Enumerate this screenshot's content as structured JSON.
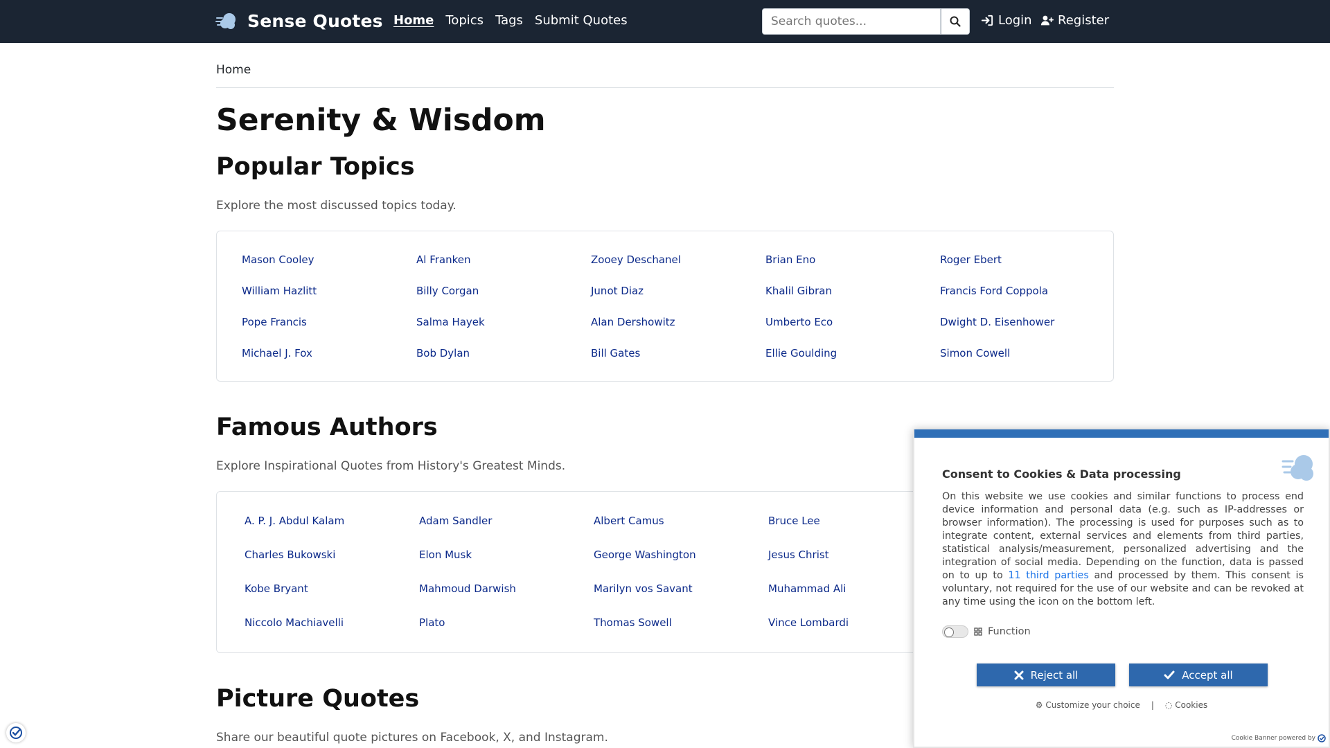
{
  "header": {
    "brand": "Sense Quotes",
    "nav": [
      "Home",
      "Topics",
      "Tags",
      "Submit Quotes"
    ],
    "search_placeholder": "Search quotes...",
    "login": "Login",
    "register": "Register"
  },
  "breadcrumb": "Home",
  "page_title": "Serenity & Wisdom",
  "popular_topics": {
    "title": "Popular Topics",
    "subtitle": "Explore the most discussed topics today.",
    "items": [
      "Mason Cooley",
      "Al Franken",
      "Zooey Deschanel",
      "Brian Eno",
      "Roger Ebert",
      "William Hazlitt",
      "Billy Corgan",
      "Junot Diaz",
      "Khalil Gibran",
      "Francis Ford Coppola",
      "Pope Francis",
      "Salma Hayek",
      "Alan Dershowitz",
      "Umberto Eco",
      "Dwight D. Eisenhower",
      "Michael J. Fox",
      "Bob Dylan",
      "Bill Gates",
      "Ellie Goulding",
      "Simon Cowell"
    ]
  },
  "famous_authors": {
    "title": "Famous Authors",
    "subtitle": "Explore Inspirational Quotes from History's Greatest Minds.",
    "items": [
      "A. P. J. Abdul Kalam",
      "Adam Sandler",
      "Albert Camus",
      "Bruce Lee",
      "",
      "Charles Bukowski",
      "Elon Musk",
      "George Washington",
      "Jesus Christ",
      "",
      "Kobe Bryant",
      "Mahmoud Darwish",
      "Marilyn vos Savant",
      "Muhammad Ali",
      "",
      "Niccolo Machiavelli",
      "Plato",
      "Thomas Sowell",
      "Vince Lombardi",
      ""
    ]
  },
  "picture_quotes": {
    "title": "Picture Quotes",
    "subtitle": "Share our beautiful quote pictures on Facebook, X, and Instagram."
  },
  "cookie": {
    "title": "Consent to Cookies & Data processing",
    "text_before": "On this website we use cookies and similar functions to process end device information and personal data (e.g. such as IP-addresses or browser information). The processing is used for purposes such as to integrate content, external services and elements from third parties, statistical analysis/measurement, personalized advertising and the integration of social media. Depending on the function, data is passed on to up to ",
    "third_parties_link": "11 third parties",
    "text_after": " and processed by them. This consent is voluntary, not required for the use of our website and can be revoked at any time using the icon on the bottom left.",
    "function_label": "Function",
    "reject": "Reject all",
    "accept": "Accept all",
    "customize": "Customize your choice",
    "cookies": "Cookies",
    "powered": "Cookie Banner powered by",
    "accent": "#2e68ad"
  },
  "colors": {
    "navbar": "#1b2533",
    "link": "#0c2a8a"
  }
}
